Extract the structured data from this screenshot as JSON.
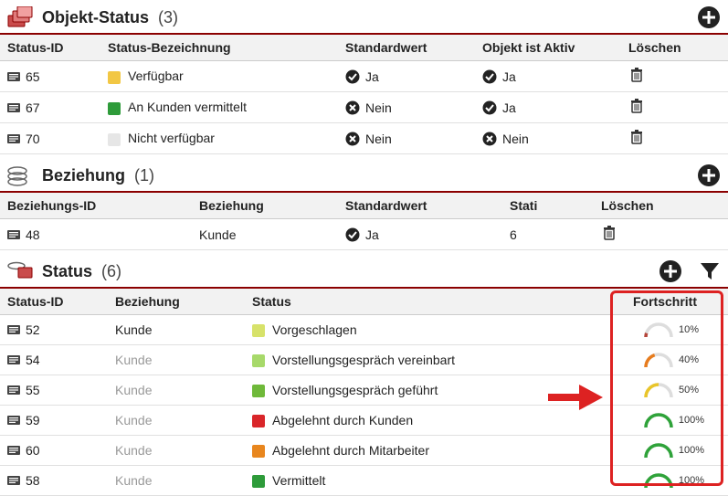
{
  "sections": {
    "objektStatus": {
      "title": "Objekt-Status",
      "count": "(3)",
      "columns": [
        "Status-ID",
        "Status-Bezeichnung",
        "Standardwert",
        "Objekt ist Aktiv",
        "Löschen"
      ],
      "rows": [
        {
          "id": "65",
          "color": "#f2c744",
          "label": "Verfügbar",
          "std": true,
          "stdText": "Ja",
          "active": true,
          "activeText": "Ja"
        },
        {
          "id": "67",
          "color": "#2e9b3a",
          "label": "An Kunden vermittelt",
          "std": false,
          "stdText": "Nein",
          "active": true,
          "activeText": "Ja"
        },
        {
          "id": "70",
          "color": "#e6e6e6",
          "label": "Nicht verfügbar",
          "std": false,
          "stdText": "Nein",
          "active": false,
          "activeText": "Nein"
        }
      ]
    },
    "beziehung": {
      "title": "Beziehung",
      "count": "(1)",
      "columns": [
        "Beziehungs-ID",
        "Beziehung",
        "Standardwert",
        "Stati",
        "Löschen"
      ],
      "rows": [
        {
          "id": "48",
          "label": "Kunde",
          "std": true,
          "stdText": "Ja",
          "stati": "6"
        }
      ]
    },
    "status": {
      "title": "Status",
      "count": "(6)",
      "columns": [
        "Status-ID",
        "Beziehung",
        "Status",
        "Fortschritt"
      ],
      "rows": [
        {
          "id": "52",
          "bez": "Kunde",
          "bezFaded": false,
          "color": "#d7e26a",
          "label": "Vorgeschlagen",
          "progress": 10,
          "progressText": "10%",
          "gaugeColor": "#b5453a"
        },
        {
          "id": "54",
          "bez": "Kunde",
          "bezFaded": true,
          "color": "#a7d96a",
          "label": "Vorstellungsgespräch vereinbart",
          "progress": 40,
          "progressText": "40%",
          "gaugeColor": "#e77c1e"
        },
        {
          "id": "55",
          "bez": "Kunde",
          "bezFaded": true,
          "color": "#6fb93a",
          "label": "Vorstellungsgespräch geführt",
          "progress": 50,
          "progressText": "50%",
          "gaugeColor": "#e9c52a"
        },
        {
          "id": "59",
          "bez": "Kunde",
          "bezFaded": true,
          "color": "#d9262a",
          "label": "Abgelehnt durch Kunden",
          "progress": 100,
          "progressText": "100%",
          "gaugeColor": "#2fa33a"
        },
        {
          "id": "60",
          "bez": "Kunde",
          "bezFaded": true,
          "color": "#e8861e",
          "label": "Abgelehnt durch Mitarbeiter",
          "progress": 100,
          "progressText": "100%",
          "gaugeColor": "#2fa33a"
        },
        {
          "id": "58",
          "bez": "Kunde",
          "bezFaded": true,
          "color": "#2e9b3a",
          "label": "Vermittelt",
          "progress": 100,
          "progressText": "100%",
          "gaugeColor": "#2fa33a"
        }
      ]
    }
  }
}
